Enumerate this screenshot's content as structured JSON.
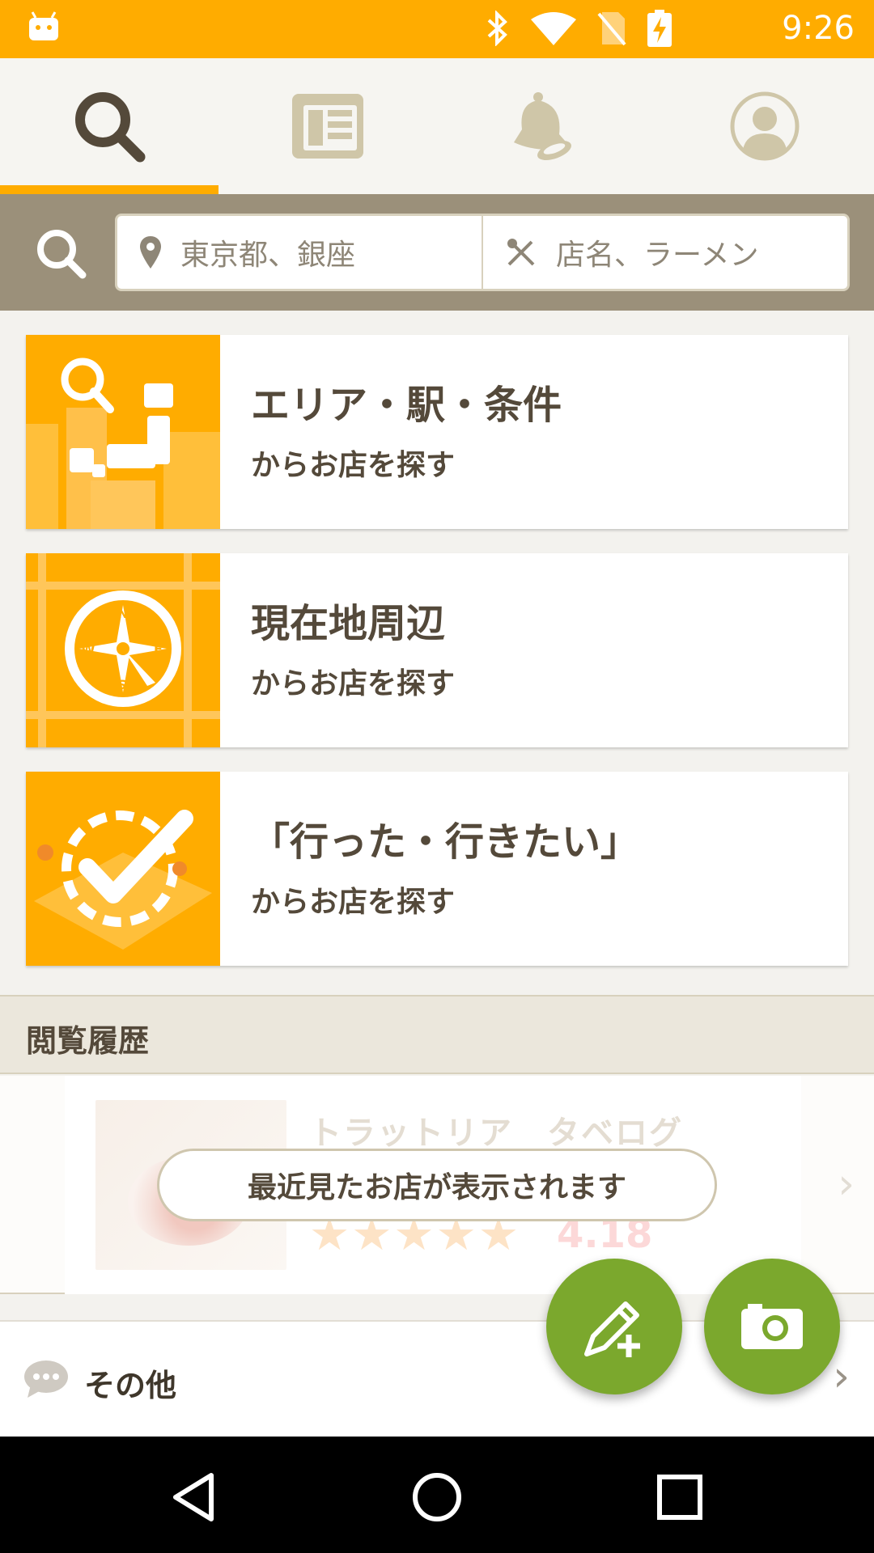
{
  "status_bar": {
    "time": "9:26"
  },
  "tabs": [
    {
      "name": "search",
      "icon": "search-icon",
      "active": true
    },
    {
      "name": "news",
      "icon": "newspaper-icon",
      "active": false
    },
    {
      "name": "notifications",
      "icon": "bell-icon",
      "active": false
    },
    {
      "name": "profile",
      "icon": "user-icon",
      "active": false
    }
  ],
  "search": {
    "area_placeholder": "東京都、銀座",
    "keyword_placeholder": "店名、ラーメン"
  },
  "cards": [
    {
      "title": "エリア・駅・条件",
      "subtitle": "からお店を探す",
      "icon": "area-map-icon"
    },
    {
      "title": "現在地周辺",
      "subtitle": "からお店を探す",
      "icon": "compass-icon"
    },
    {
      "title": "「行った・行きたい」",
      "subtitle": "からお店を探す",
      "icon": "checkmark-icon"
    }
  ],
  "history": {
    "header": "閲覧履歴",
    "placeholder_restaurant": "トラットリア　タベログ",
    "placeholder_stars": "★★★★★",
    "placeholder_score": "4.18",
    "empty_message": "最近見たお店が表示されます"
  },
  "other": {
    "label": "その他"
  },
  "fabs": [
    {
      "icon": "write-review-icon"
    },
    {
      "icon": "camera-icon"
    }
  ],
  "colors": {
    "accent": "#ffac00",
    "search_band": "#9b907a",
    "fab": "#7ba82d"
  }
}
